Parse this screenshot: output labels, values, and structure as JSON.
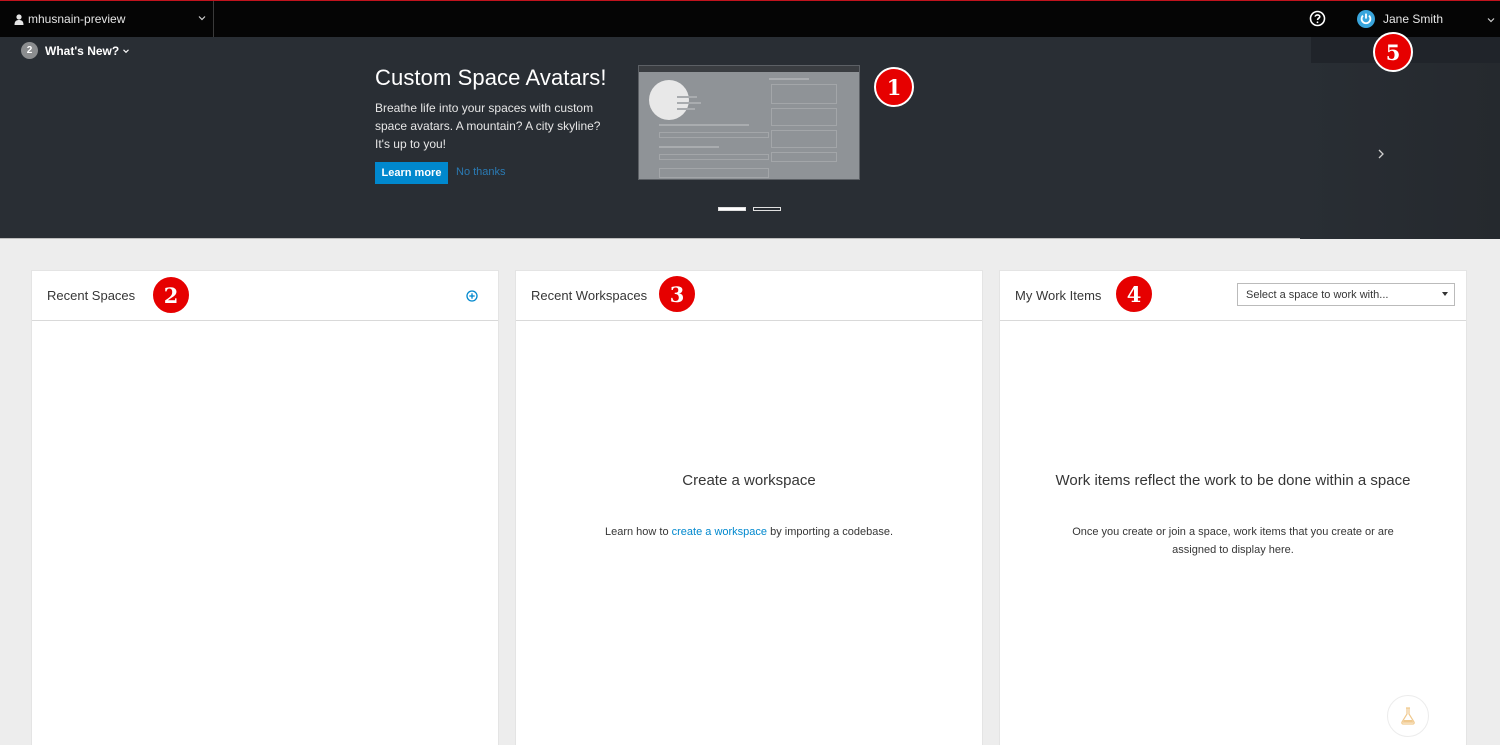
{
  "topbar": {
    "context": "mhusnain-preview",
    "user_name": "Jane Smith",
    "icons": {
      "context_user": "user-icon",
      "context_chevron": "chevron-down-icon",
      "help": "help-circle-icon",
      "avatar": "power-avatar-icon",
      "user_chevron": "chevron-down-icon"
    }
  },
  "banner": {
    "whats_new_count": "2",
    "whats_new_label": "What's New?",
    "title": "Custom Space Avatars!",
    "description": "Breathe life into your spaces with custom space avatars. A mountain? A city skyline? It's up to you!",
    "learn_more": "Learn more",
    "no_thanks": "No thanks",
    "slides": 2,
    "active_slide": 1,
    "icons": {
      "next": "chevron-right-icon"
    }
  },
  "callouts": [
    "1",
    "2",
    "3",
    "4",
    "5"
  ],
  "cards": {
    "recent_spaces": {
      "title": "Recent Spaces",
      "add_icon": "plus-circle-icon"
    },
    "recent_workspaces": {
      "title": "Recent Workspaces",
      "empty_title": "Create a workspace",
      "empty_prefix": "Learn how to ",
      "empty_link": "create a workspace",
      "empty_suffix": " by importing a codebase."
    },
    "my_work_items": {
      "title": "My Work Items",
      "select_value": "Select a space to work with...",
      "empty_title": "Work items reflect the work to be done within a space",
      "empty_text": "Once you create or join a space, work items that you create or are assigned to display here."
    }
  },
  "colors": {
    "topbar": "#050505",
    "topbar_accent": "#c0131d",
    "banner": "#292e34",
    "primary": "#0088ce",
    "callout": "#e60000",
    "page_bg": "#ededed"
  },
  "floating_button_icon": "flask-icon"
}
